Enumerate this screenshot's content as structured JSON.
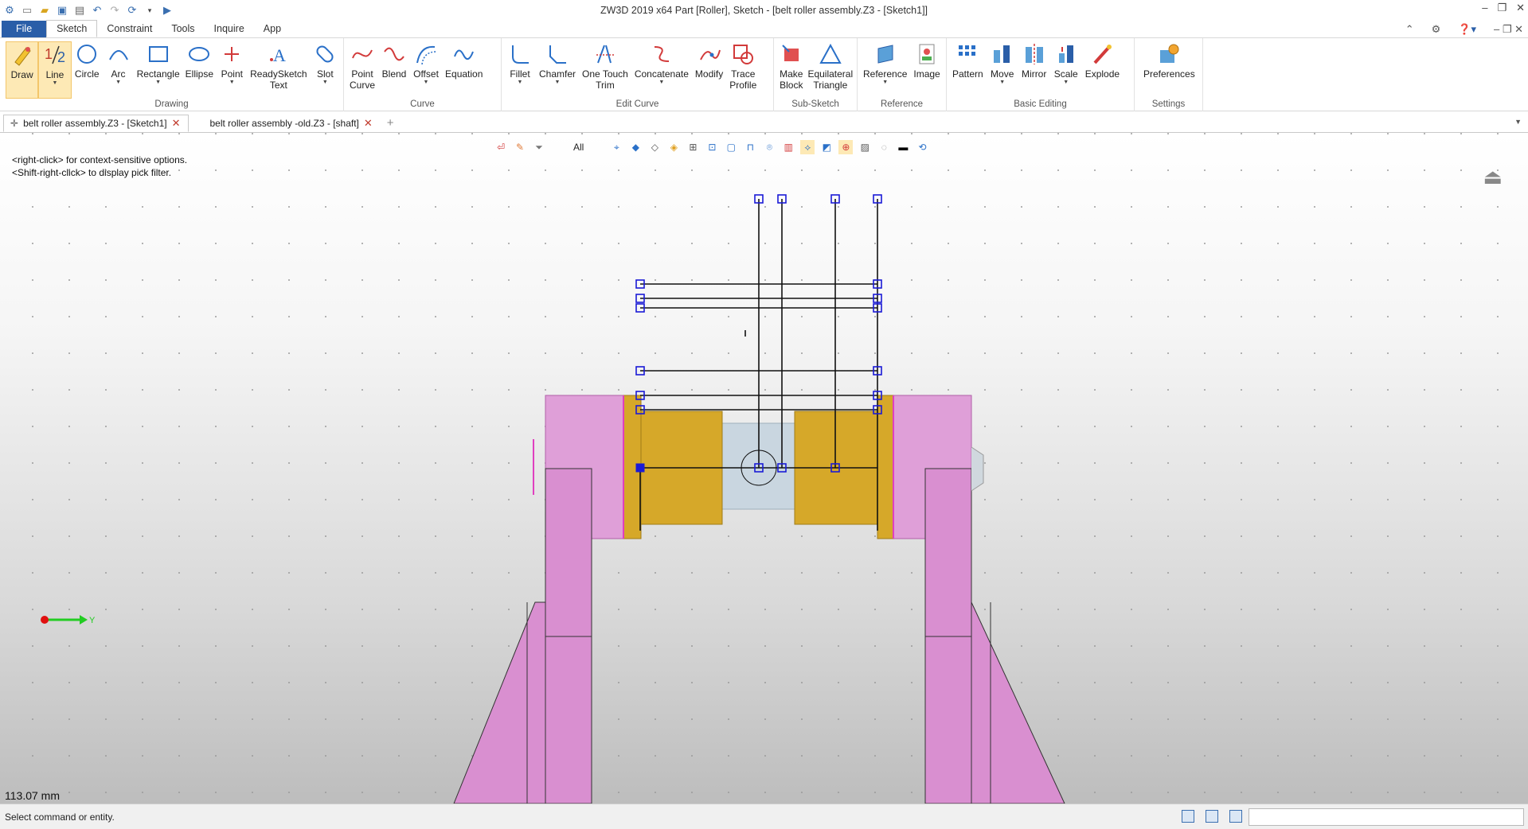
{
  "titlebar": {
    "title": "ZW3D 2019  x64          Part [Roller],  Sketch - [belt roller assembly.Z3 - [Sketch1]]"
  },
  "menu": {
    "file": "File",
    "tabs": [
      "Sketch",
      "Constraint",
      "Tools",
      "Inquire",
      "App"
    ]
  },
  "ribbon": {
    "groups": {
      "drawing": "Drawing",
      "curve": "Curve",
      "edit_curve": "Edit Curve",
      "sub_sketch": "Sub-Sketch",
      "reference": "Reference",
      "basic_editing": "Basic Editing",
      "settings": "Settings"
    },
    "buttons": {
      "draw": "Draw",
      "line": "Line",
      "circle": "Circle",
      "arc": "Arc",
      "rectangle": "Rectangle",
      "ellipse": "Ellipse",
      "point": "Point",
      "readysketch_1": "ReadySketch",
      "readysketch_2": "Text",
      "slot": "Slot",
      "point_curve_1": "Point",
      "point_curve_2": "Curve",
      "blend": "Blend",
      "offset": "Offset",
      "equation": "Equation",
      "fillet": "Fillet",
      "chamfer": "Chamfer",
      "one_touch_1": "One Touch",
      "one_touch_2": "Trim",
      "concatenate": "Concatenate",
      "modify": "Modify",
      "trace_1": "Trace",
      "trace_2": "Profile",
      "make_block_1": "Make",
      "make_block_2": "Block",
      "eq_tri_1": "Equilateral",
      "eq_tri_2": "Triangle",
      "reference": "Reference",
      "image": "Image",
      "pattern": "Pattern",
      "move": "Move",
      "mirror": "Mirror",
      "scale": "Scale",
      "explode": "Explode",
      "preferences": "Preferences"
    }
  },
  "doctabs": [
    {
      "label": "belt roller assembly.Z3 - [Sketch1]"
    },
    {
      "label": "belt roller assembly -old.Z3 - [shaft]"
    }
  ],
  "viewport": {
    "hint_line1": "<right-click> for context-sensitive options.",
    "hint_line2": "<Shift-right-click> to display pick filter.",
    "filter": "All",
    "measure": "113.07 mm",
    "axis_label": "Y"
  },
  "status": {
    "text": "Select command or entity."
  },
  "colors": {
    "accent": "#2a5ea8",
    "pink_part": "#d98fd0",
    "gold_part": "#d6a829",
    "shaft": "#c9d6e0",
    "handle": "#1a1ad6"
  }
}
